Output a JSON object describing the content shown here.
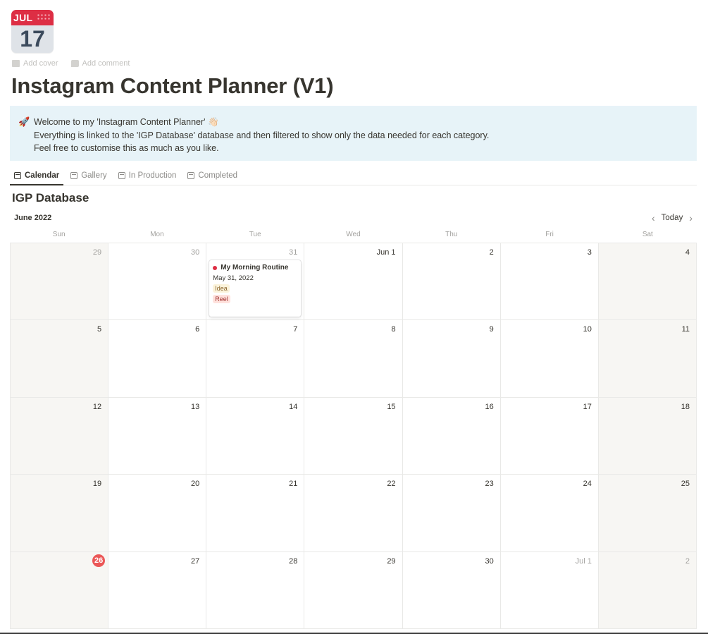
{
  "page_icon": {
    "month": "JUL",
    "day": "17",
    "name": "calendar-icon"
  },
  "actions": {
    "add_cover": "Add cover",
    "add_comment": "Add comment"
  },
  "title": "Instagram Content Planner (V1)",
  "callout": {
    "icon": "rocket-icon",
    "line1": "Welcome to my 'Instagram Content Planner' 👋🏻",
    "line2": "Everything is linked to the 'IGP Database' database and then filtered to show only the data needed for each category.",
    "line3": "Feel free to customise this as much as you like."
  },
  "tabs": [
    {
      "label": "Calendar",
      "active": true
    },
    {
      "label": "Gallery",
      "active": false
    },
    {
      "label": "In Production",
      "active": false
    },
    {
      "label": "Completed",
      "active": false
    }
  ],
  "database_title": "IGP Database",
  "calendar": {
    "month_label": "June 2022",
    "today_label": "Today",
    "weekdays": [
      "Sun",
      "Mon",
      "Tue",
      "Wed",
      "Thu",
      "Fri",
      "Sat"
    ],
    "weeks": [
      [
        "29",
        "30",
        "31",
        "Jun 1",
        "2",
        "3",
        "4"
      ],
      [
        "5",
        "6",
        "7",
        "8",
        "9",
        "10",
        "11"
      ],
      [
        "12",
        "13",
        "14",
        "15",
        "16",
        "17",
        "18"
      ],
      [
        "19",
        "20",
        "21",
        "22",
        "23",
        "24",
        "25"
      ],
      [
        "26",
        "27",
        "28",
        "29",
        "30",
        "Jul 1",
        "2"
      ]
    ],
    "today": "26",
    "event": {
      "title": "My Morning Routine",
      "date": "May 31, 2022",
      "tags": [
        "Idea",
        "Reel"
      ],
      "dot_color": "#dd2e44"
    }
  }
}
